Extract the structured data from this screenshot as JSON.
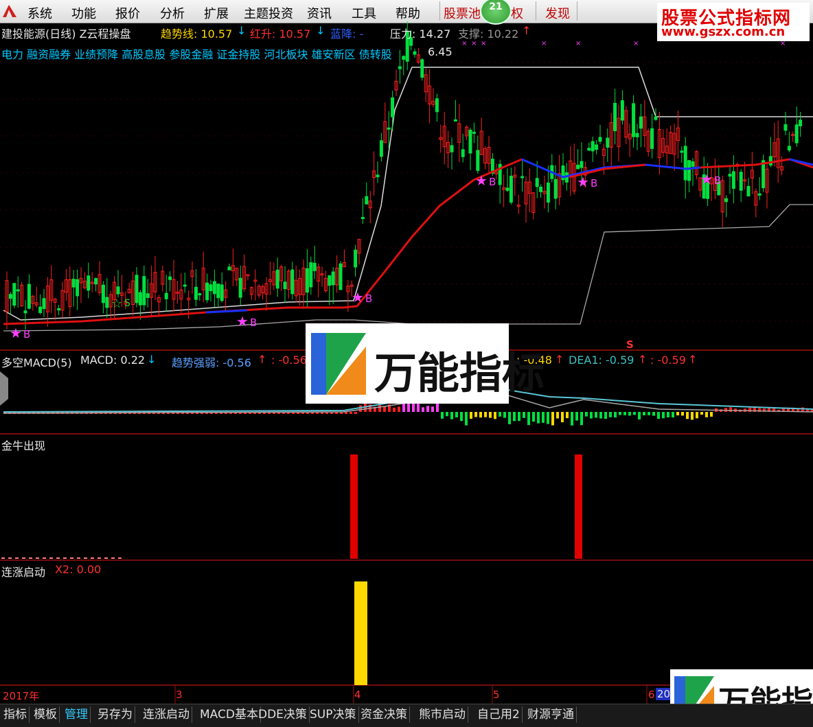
{
  "menu": {
    "items": [
      "系统",
      "功能",
      "报价",
      "分析",
      "扩展",
      "主题投资",
      "资讯",
      "工具",
      "帮助"
    ],
    "special": [
      "股票池",
      "权",
      "发现"
    ],
    "badge": "21"
  },
  "site_logo": {
    "line1": "股票公式指标网",
    "line2": "www.gszx.com.cn"
  },
  "main": {
    "stock_title": "建投能源(日线) Z云程操盘",
    "trend_label": "趋势线: 10.57",
    "trend_arrow": "↓",
    "red_label": "红升: 10.57",
    "red_arrow": "↓",
    "blue_label": "蓝降: -",
    "pressure_label": "压力: 14.27",
    "support_label": "支撑: 10.22",
    "support_arrow": "↑",
    "concepts": "电力 融资融券 业绩预降 高股息股 参股金融 证金持股 河北板块 雄安新区 债转股",
    "price_overlay": "6.45"
  },
  "macd": {
    "title": "多空MACD(5)",
    "macd_value": "MACD: 0.22",
    "macd_arrow": "↓",
    "strength_label": "趋势强弱: -0.56",
    "strength_arrow": "↑",
    "dup_value": ": -0.56",
    "dif_value": ": -0.48",
    "dif_arrow": "↑",
    "dea_label": "DEA1: -0.59",
    "dea_arrow": "↑",
    "dea_dup": ": -0.59",
    "dea_dup_arrow": "↑",
    "sell_mark": "S"
  },
  "panel3": {
    "title": "金牛出现"
  },
  "panel4": {
    "title": "连涨启动",
    "value": "X2: 0.00"
  },
  "markers": {
    "buy": "B",
    "sell": "S",
    "star": "★",
    "hollow_star": "☆"
  },
  "timeline": {
    "labels": [
      "2017年",
      "3",
      "4",
      "5",
      "6",
      "20"
    ]
  },
  "watermark": {
    "text": "万能指标"
  },
  "tabs": [
    "指标",
    "模板",
    "管理",
    "另存为",
    "连涨启动",
    "MACD基本",
    "DDE决策",
    "SUP决策",
    "资金决策",
    "熊市启动",
    "自己用2",
    "财源亨通"
  ],
  "colors": {
    "up": "#ff2020",
    "down": "#00e040",
    "trend_up": "#e01010",
    "trend_down": "#1a30ff",
    "gold_bull": "#e00000",
    "launch": "#ffd800"
  }
}
